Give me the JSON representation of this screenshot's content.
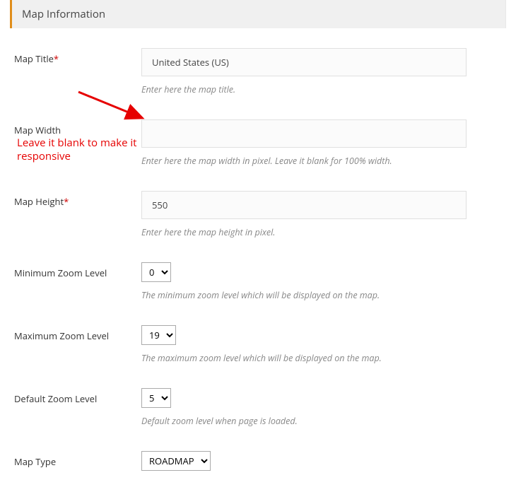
{
  "panel": {
    "title": "Map Information"
  },
  "fields": {
    "title": {
      "label": "Map Title",
      "required": "*",
      "value": "United States (US)",
      "help": "Enter here the map title."
    },
    "width": {
      "label": "Map Width",
      "value": "",
      "help": "Enter here the map width in pixel. Leave it blank for 100% width."
    },
    "height": {
      "label": "Map Height",
      "required": "*",
      "value": "550",
      "help": "Enter here the map height in pixel."
    },
    "min_zoom": {
      "label": "Minimum Zoom Level",
      "value": "0",
      "help": "The minimum zoom level which will be displayed on the map."
    },
    "max_zoom": {
      "label": "Maximum Zoom Level",
      "value": "19",
      "help": "The maximum zoom level which will be displayed on the map."
    },
    "default_zoom": {
      "label": "Default Zoom Level",
      "value": "5",
      "help": "Default zoom level when page is loaded."
    },
    "map_type": {
      "label": "Map Type",
      "value": "ROADMAP"
    }
  },
  "annotation": {
    "text": "Leave it blank to make it responsive"
  }
}
